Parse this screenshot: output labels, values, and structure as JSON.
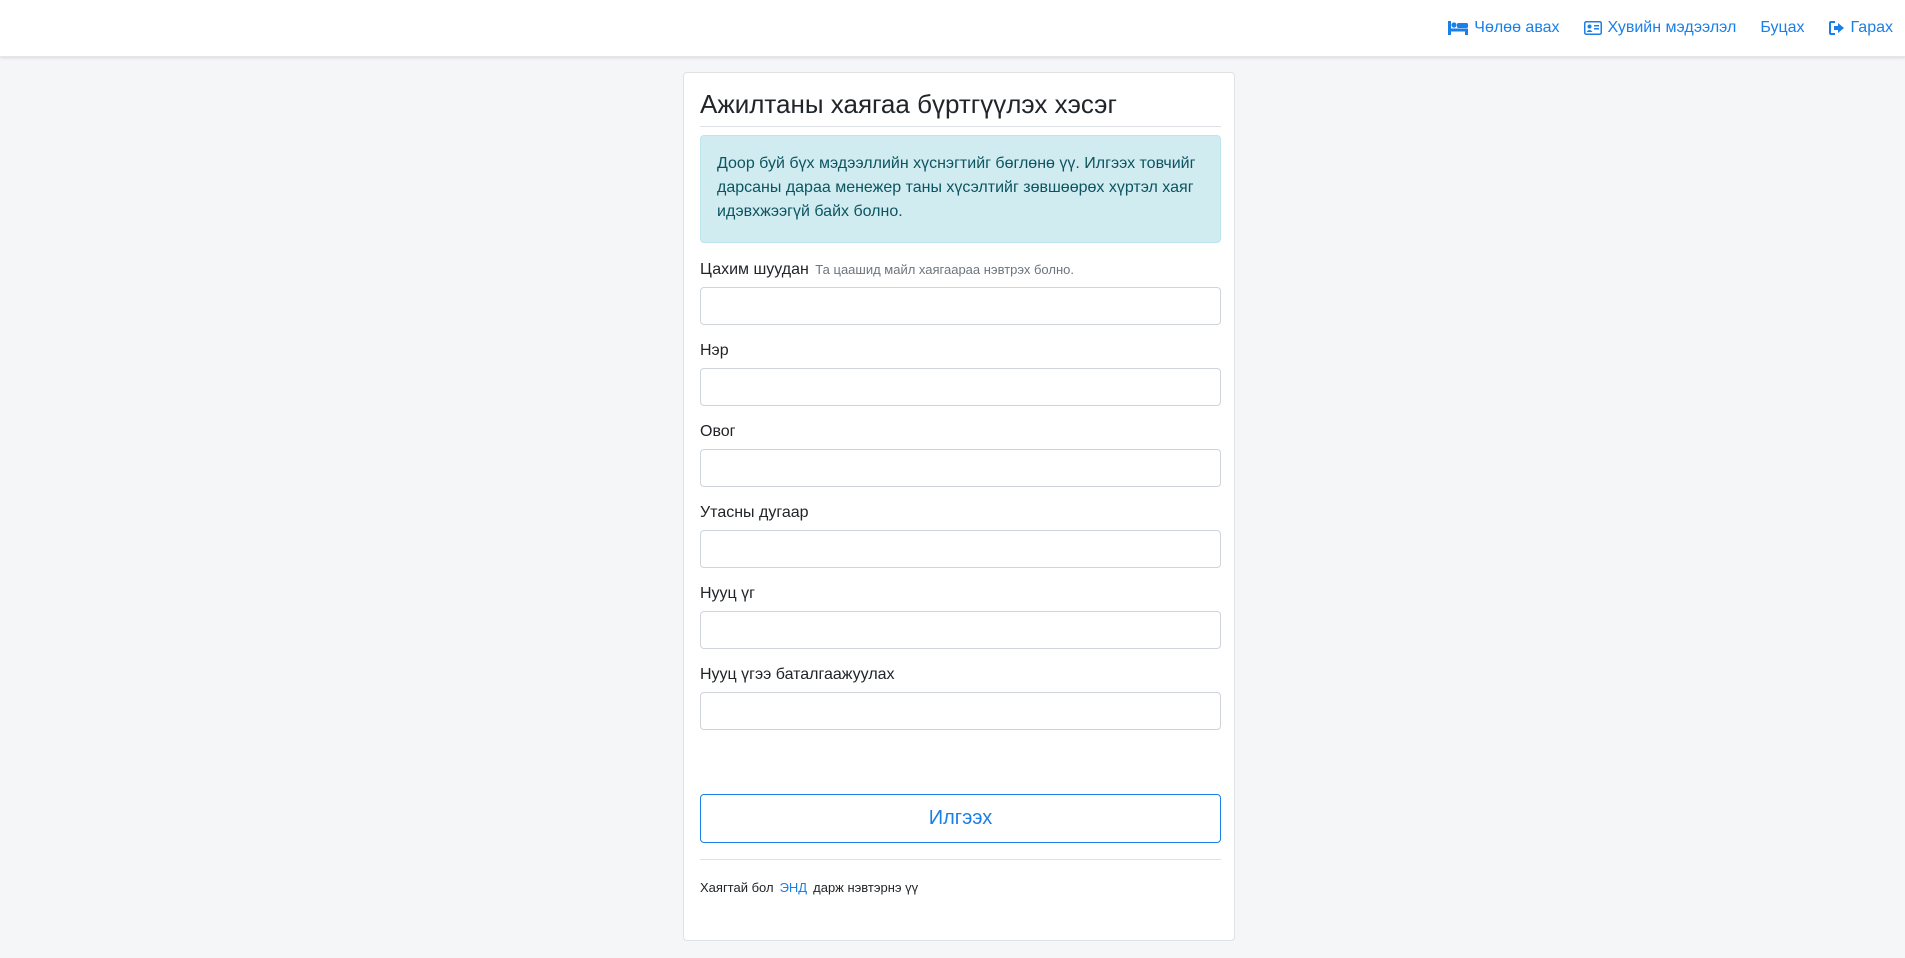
{
  "nav": {
    "items": [
      {
        "label": "Чөлөө авах",
        "icon": "bed-icon"
      },
      {
        "label": "Хувийн мэдээлэл",
        "icon": "id-card-icon"
      },
      {
        "label": "Буцах",
        "icon": ""
      },
      {
        "label": "Гарах",
        "icon": "sign-out-icon"
      }
    ]
  },
  "form": {
    "title": "Ажилтаны хаягаа бүртгүүлэх хэсэг",
    "notice": "Доор буй бүх мэдээллийн хүснэгтийг бөглөнө үү. Илгээх товчийг дарсаны дараа менежер таны хүсэлтийг зөвшөөрөх хүртэл хаяг идэвхжээгүй байх болно.",
    "email_label": "Цахим шуудан",
    "email_hint": "Та цаашид майл хаягаараа нэвтрэх болно.",
    "email_value": "",
    "first_name_label": "Нэр",
    "first_name_value": "",
    "last_name_label": "Овог",
    "last_name_value": "",
    "phone_label": "Утасны дугаар",
    "phone_value": "",
    "password_label": "Нууц үг",
    "password_value": "",
    "password_confirm_label": "Нууц үгээ баталгаажуулах",
    "password_confirm_value": "",
    "submit_label": "Илгээх"
  },
  "footer": {
    "prefix": "Хаягтай бол",
    "link": "ЭНД",
    "suffix": "дарж нэвтэрнэ үү"
  },
  "colors": {
    "accent": "#1a7fe6",
    "alert_bg": "#d1ecf1",
    "alert_text": "#0c5460",
    "page_bg": "#f5f6f7"
  }
}
